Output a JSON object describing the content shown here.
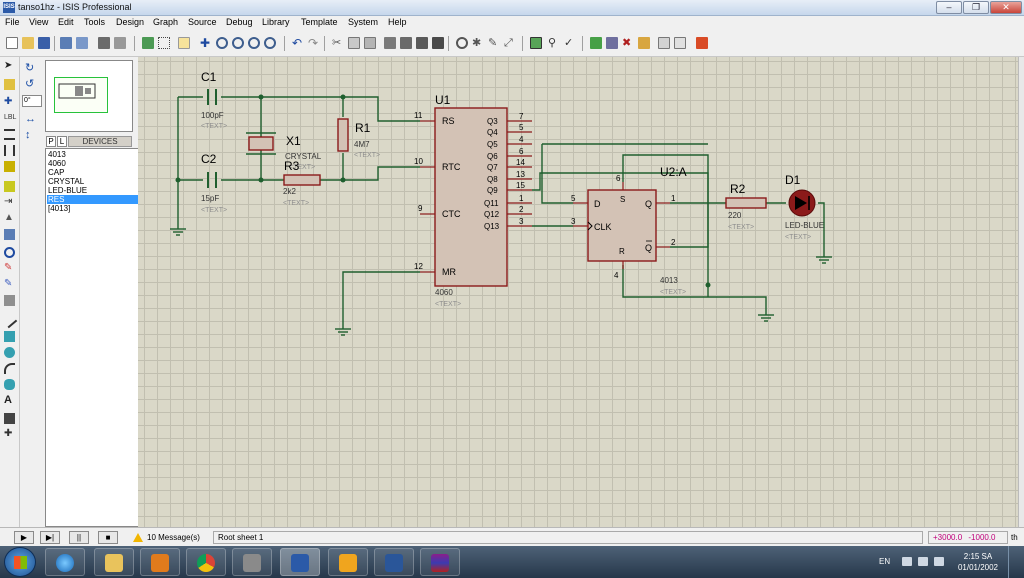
{
  "window": {
    "title": "tanso1hz - ISIS Professional",
    "app_icon_text": "ISIS"
  },
  "menu": [
    "File",
    "View",
    "Edit",
    "Tools",
    "Design",
    "Graph",
    "Source",
    "Debug",
    "Library",
    "Template",
    "System",
    "Help"
  ],
  "side_panel": {
    "angle_value": "0°",
    "p_label": "P",
    "l_label": "L",
    "devices_header": "DEVICES",
    "devices": [
      "4013",
      "4060",
      "CAP",
      "CRYSTAL",
      "LED-BLUE",
      "RES",
      "[4013]"
    ],
    "selected_device": "RES"
  },
  "schematic": {
    "components": {
      "C1": {
        "ref": "C1",
        "value": "100pF",
        "text": "<TEXT>"
      },
      "C2": {
        "ref": "C2",
        "value": "15pF",
        "text": "<TEXT>"
      },
      "X1": {
        "ref": "X1",
        "value": "CRYSTAL",
        "text": "<TEXT>"
      },
      "R1": {
        "ref": "R1",
        "value": "4M7",
        "text": "<TEXT>"
      },
      "R3": {
        "ref": "R3",
        "value": "2k2",
        "text": "<TEXT>"
      },
      "U1": {
        "ref": "U1",
        "value": "4060",
        "text": "<TEXT>",
        "pins_left": [
          {
            "num": "11",
            "name": "RS"
          },
          {
            "num": "10",
            "name": "RTC"
          },
          {
            "num": "9",
            "name": "CTC"
          },
          {
            "num": "12",
            "name": "MR"
          }
        ],
        "pins_right": [
          {
            "num": "7",
            "name": "Q3"
          },
          {
            "num": "5",
            "name": "Q4"
          },
          {
            "num": "4",
            "name": "Q5"
          },
          {
            "num": "6",
            "name": "Q6"
          },
          {
            "num": "14",
            "name": "Q7"
          },
          {
            "num": "13",
            "name": "Q8"
          },
          {
            "num": "15",
            "name": "Q9"
          },
          {
            "num": "1",
            "name": "Q11"
          },
          {
            "num": "2",
            "name": "Q12"
          },
          {
            "num": "3",
            "name": "Q13"
          }
        ]
      },
      "U2A": {
        "ref": "U2:A",
        "value": "4013",
        "text": "<TEXT>",
        "pins": {
          "d": {
            "num": "5",
            "name": "D"
          },
          "s": {
            "num": "6",
            "name": "S"
          },
          "q": {
            "num": "1",
            "name": "Q"
          },
          "clk": {
            "num": "3",
            "name": "CLK"
          },
          "r": {
            "num": "4",
            "name": "R"
          },
          "qbar": {
            "num": "2",
            "name": "Q"
          }
        }
      },
      "R2": {
        "ref": "R2",
        "value": "220",
        "text": "<TEXT>"
      },
      "D1": {
        "ref": "D1",
        "value": "LED-BLUE",
        "text": "<TEXT>"
      }
    }
  },
  "status": {
    "play_buttons": [
      "▶",
      "▶|",
      "||",
      "■"
    ],
    "messages": "10 Message(s)",
    "sheet": "Root sheet 1",
    "x_coord": "+3000.0",
    "y_coord": "-1000.0",
    "unit": "th"
  },
  "taskbar": {
    "language": "EN",
    "time": "2:15 SA",
    "date": "01/01/2002"
  },
  "colors": {
    "wire": "#1f5f2e",
    "component": "#8b1a1a",
    "chip_fill": "#d3c2b5",
    "canvas": "#dad8c8",
    "led": "#b00000"
  }
}
